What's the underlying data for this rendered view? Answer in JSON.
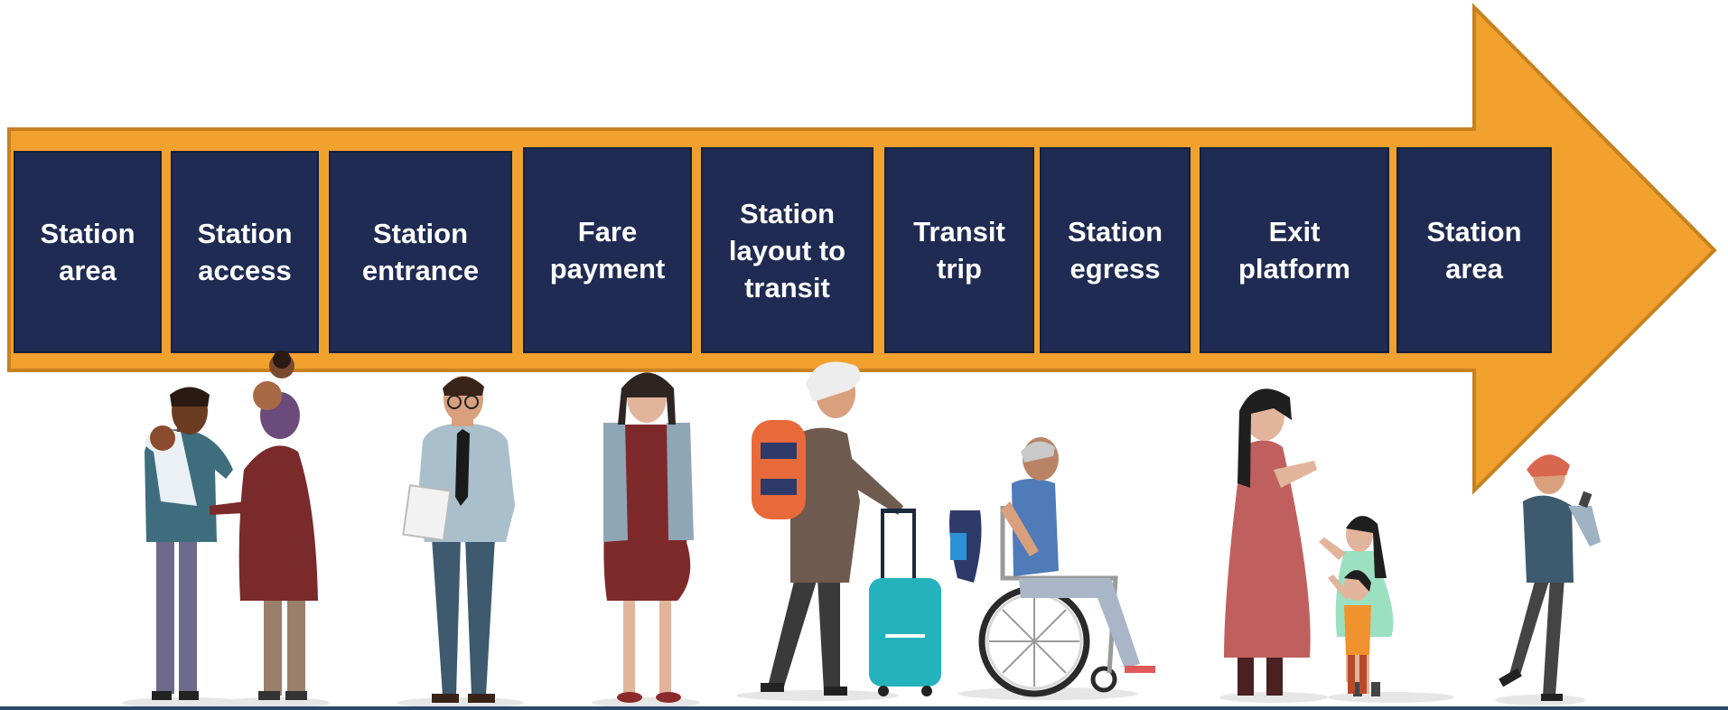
{
  "colors": {
    "arrow_fill": "#F0A12E",
    "arrow_stroke": "#C8811F",
    "box_fill": "#1F2B52",
    "box_text": "#FFFFFF",
    "title": "#E8781E"
  },
  "stages": [
    {
      "label": "Station\narea"
    },
    {
      "label": "Station\naccess"
    },
    {
      "label": "Station\nentrance"
    },
    {
      "label": "Fare\npayment"
    },
    {
      "label": "Station\nlayout to\ntransit"
    },
    {
      "label": "Transit\ntrip"
    },
    {
      "label": "Station\negress"
    },
    {
      "label": "Exit\nplatform"
    },
    {
      "label": "Station\narea"
    }
  ],
  "people": [
    {
      "icon": "parent-with-baby-icon"
    },
    {
      "icon": "parent-carrying-child-icon"
    },
    {
      "icon": "office-worker-icon"
    },
    {
      "icon": "pregnant-woman-icon"
    },
    {
      "icon": "backpacker-with-luggage-icon"
    },
    {
      "icon": "wheelchair-user-icon"
    },
    {
      "icon": "woman-with-children-icon"
    },
    {
      "icon": "child-with-phone-icon"
    }
  ]
}
